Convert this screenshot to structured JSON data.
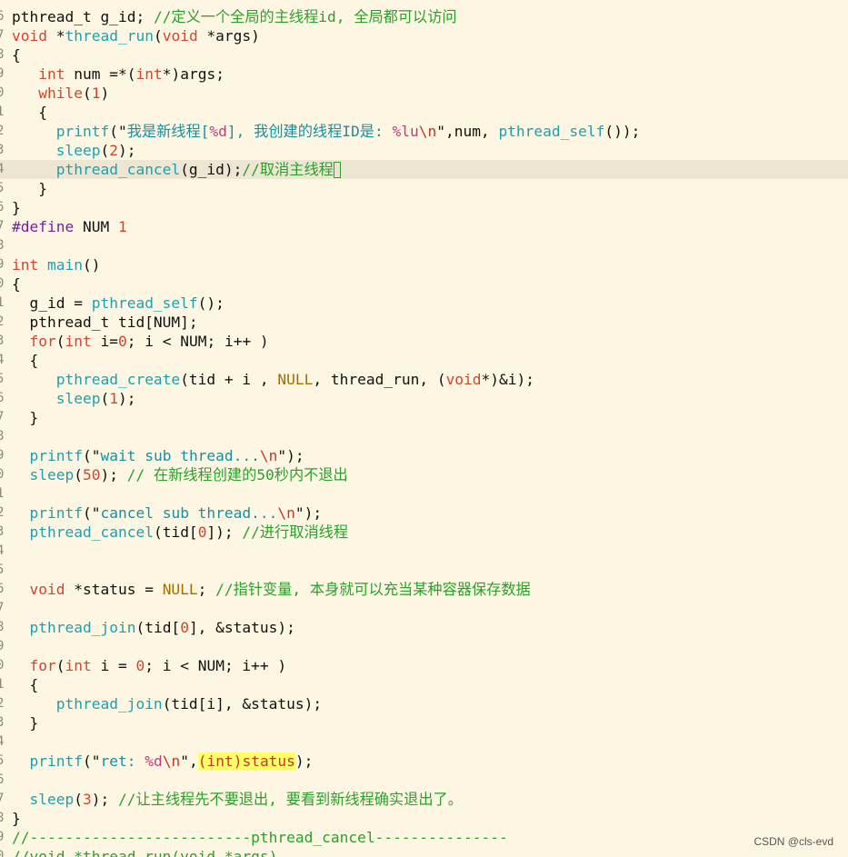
{
  "editor": {
    "cursor_line": 9,
    "lines": [
      {
        "g": "6",
        "t": [
          [
            "pthread_t g_id; ",
            "d"
          ],
          [
            "//定义一个全局的主线程id, 全局都可以访问",
            "c"
          ]
        ]
      },
      {
        "g": "7",
        "t": [
          [
            "void",
            "k"
          ],
          [
            " *",
            "d"
          ],
          [
            "thread_run",
            "f"
          ],
          [
            "(",
            "d"
          ],
          [
            "void",
            "k"
          ],
          [
            " *args)",
            "d"
          ]
        ]
      },
      {
        "g": "8",
        "t": [
          [
            "{",
            "d"
          ]
        ]
      },
      {
        "g": "9",
        "t": [
          [
            "   ",
            "d"
          ],
          [
            "int",
            "k"
          ],
          [
            " num =*(",
            "d"
          ],
          [
            "int",
            "k"
          ],
          [
            "*)args;",
            "d"
          ]
        ]
      },
      {
        "g": "0",
        "t": [
          [
            "   ",
            "d"
          ],
          [
            "while",
            "k"
          ],
          [
            "(",
            "d"
          ],
          [
            "1",
            "n"
          ],
          [
            ")",
            "d"
          ]
        ]
      },
      {
        "g": "1",
        "t": [
          [
            "   {",
            "d"
          ]
        ]
      },
      {
        "g": "2",
        "t": [
          [
            "     ",
            "d"
          ],
          [
            "printf",
            "f"
          ],
          [
            "(\"",
            "d"
          ],
          [
            "我是新线程[",
            "s"
          ],
          [
            "%d",
            "fmt"
          ],
          [
            "], 我创建的线程ID是: ",
            "s"
          ],
          [
            "%lu",
            "fmt"
          ],
          [
            "\\n",
            "esc"
          ],
          [
            "\"",
            "d"
          ],
          [
            ",num, ",
            "d"
          ],
          [
            "pthread_self",
            "f"
          ],
          [
            "());",
            "d"
          ]
        ]
      },
      {
        "g": "3",
        "t": [
          [
            "     ",
            "d"
          ],
          [
            "sleep",
            "f"
          ],
          [
            "(",
            "d"
          ],
          [
            "2",
            "n"
          ],
          [
            ");",
            "d"
          ]
        ]
      },
      {
        "g": "4",
        "t": [
          [
            "     ",
            "d"
          ],
          [
            "pthread_cancel",
            "f"
          ],
          [
            "(g_id);",
            "d"
          ],
          [
            "//取消主线程",
            "c"
          ]
        ],
        "cursor": true
      },
      {
        "g": "5",
        "t": [
          [
            "   }",
            "d"
          ]
        ]
      },
      {
        "g": "6",
        "t": [
          [
            "}",
            "d"
          ]
        ]
      },
      {
        "g": "7",
        "t": [
          [
            "#define",
            "pp"
          ],
          [
            " NUM ",
            "d"
          ],
          [
            "1",
            "n"
          ]
        ]
      },
      {
        "g": "8",
        "t": [
          [
            "",
            "d"
          ]
        ]
      },
      {
        "g": "9",
        "t": [
          [
            "int",
            "k"
          ],
          [
            " ",
            "d"
          ],
          [
            "main",
            "f"
          ],
          [
            "()",
            "d"
          ]
        ]
      },
      {
        "g": "0",
        "t": [
          [
            "{",
            "d"
          ]
        ]
      },
      {
        "g": "1",
        "t": [
          [
            "  g_id = ",
            "d"
          ],
          [
            "pthread_self",
            "f"
          ],
          [
            "();",
            "d"
          ]
        ]
      },
      {
        "g": "2",
        "t": [
          [
            "  pthread_t tid[NUM];",
            "d"
          ]
        ]
      },
      {
        "g": "3",
        "t": [
          [
            "  ",
            "d"
          ],
          [
            "for",
            "k"
          ],
          [
            "(",
            "d"
          ],
          [
            "int",
            "k"
          ],
          [
            " i=",
            "d"
          ],
          [
            "0",
            "n"
          ],
          [
            "; i < NUM; i++ )",
            "d"
          ]
        ]
      },
      {
        "g": "4",
        "t": [
          [
            "  {",
            "d"
          ]
        ]
      },
      {
        "g": "5",
        "t": [
          [
            "     ",
            "d"
          ],
          [
            "pthread_create",
            "f"
          ],
          [
            "(tid + i , ",
            "d"
          ],
          [
            "NULL",
            "null"
          ],
          [
            ", thread_run, (",
            "d"
          ],
          [
            "void",
            "k"
          ],
          [
            "*)&i);",
            "d"
          ]
        ]
      },
      {
        "g": "6",
        "t": [
          [
            "     ",
            "d"
          ],
          [
            "sleep",
            "f"
          ],
          [
            "(",
            "d"
          ],
          [
            "1",
            "n"
          ],
          [
            ");",
            "d"
          ]
        ]
      },
      {
        "g": "7",
        "t": [
          [
            "  }",
            "d"
          ]
        ]
      },
      {
        "g": "8",
        "t": [
          [
            "",
            "d"
          ]
        ]
      },
      {
        "g": "9",
        "t": [
          [
            "  ",
            "d"
          ],
          [
            "printf",
            "f"
          ],
          [
            "(\"",
            "d"
          ],
          [
            "wait sub thread...",
            "s"
          ],
          [
            "\\n",
            "esc"
          ],
          [
            "\");",
            "d"
          ]
        ]
      },
      {
        "g": "0",
        "t": [
          [
            "  ",
            "d"
          ],
          [
            "sleep",
            "f"
          ],
          [
            "(",
            "d"
          ],
          [
            "50",
            "n"
          ],
          [
            "); ",
            "d"
          ],
          [
            "// 在新线程创建的50秒内不退出",
            "c"
          ]
        ]
      },
      {
        "g": "1",
        "t": [
          [
            "",
            "d"
          ]
        ]
      },
      {
        "g": "2",
        "t": [
          [
            "  ",
            "d"
          ],
          [
            "printf",
            "f"
          ],
          [
            "(\"",
            "d"
          ],
          [
            "cancel sub thread...",
            "s"
          ],
          [
            "\\n",
            "esc"
          ],
          [
            "\");",
            "d"
          ]
        ]
      },
      {
        "g": "3",
        "t": [
          [
            "  ",
            "d"
          ],
          [
            "pthread_cancel",
            "f"
          ],
          [
            "(tid[",
            "d"
          ],
          [
            "0",
            "n"
          ],
          [
            "]); ",
            "d"
          ],
          [
            "//进行取消线程",
            "c"
          ]
        ]
      },
      {
        "g": "4",
        "t": [
          [
            "",
            "d"
          ]
        ]
      },
      {
        "g": "5",
        "t": [
          [
            "",
            "d"
          ]
        ]
      },
      {
        "g": "6",
        "t": [
          [
            "  ",
            "d"
          ],
          [
            "void",
            "k"
          ],
          [
            " *status = ",
            "d"
          ],
          [
            "NULL",
            "null"
          ],
          [
            "; ",
            "d"
          ],
          [
            "//指针变量, 本身就可以充当某种容器保存数据",
            "c"
          ]
        ]
      },
      {
        "g": "7",
        "t": [
          [
            "",
            "d"
          ]
        ]
      },
      {
        "g": "8",
        "t": [
          [
            "  ",
            "d"
          ],
          [
            "pthread_join",
            "f"
          ],
          [
            "(tid[",
            "d"
          ],
          [
            "0",
            "n"
          ],
          [
            "], &status);",
            "d"
          ]
        ]
      },
      {
        "g": "9",
        "t": [
          [
            "",
            "d"
          ]
        ]
      },
      {
        "g": "0",
        "t": [
          [
            "  ",
            "d"
          ],
          [
            "for",
            "k"
          ],
          [
            "(",
            "d"
          ],
          [
            "int",
            "k"
          ],
          [
            " i = ",
            "d"
          ],
          [
            "0",
            "n"
          ],
          [
            "; i < NUM; i++ )",
            "d"
          ]
        ]
      },
      {
        "g": "1",
        "t": [
          [
            "  {",
            "d"
          ]
        ]
      },
      {
        "g": "2",
        "t": [
          [
            "     ",
            "d"
          ],
          [
            "pthread_join",
            "f"
          ],
          [
            "(tid[i], &status);",
            "d"
          ]
        ]
      },
      {
        "g": "3",
        "t": [
          [
            "  }",
            "d"
          ]
        ]
      },
      {
        "g": "4",
        "t": [
          [
            "",
            "d"
          ]
        ]
      },
      {
        "g": "5",
        "t": [
          [
            "  ",
            "d"
          ],
          [
            "printf",
            "f"
          ],
          [
            "(\"",
            "d"
          ],
          [
            "ret: ",
            "s"
          ],
          [
            "%d",
            "fmt"
          ],
          [
            "\\n",
            "esc"
          ],
          [
            "\",",
            "d"
          ],
          [
            "(int)status",
            "hl"
          ],
          [
            ");",
            "d"
          ]
        ]
      },
      {
        "g": "6",
        "t": [
          [
            "",
            "d"
          ]
        ]
      },
      {
        "g": "7",
        "t": [
          [
            "  ",
            "d"
          ],
          [
            "sleep",
            "f"
          ],
          [
            "(",
            "d"
          ],
          [
            "3",
            "n"
          ],
          [
            "); ",
            "d"
          ],
          [
            "//让主线程先不要退出, 要看到新线程确实退出了。",
            "c"
          ]
        ]
      },
      {
        "g": "8",
        "t": [
          [
            "}",
            "d"
          ]
        ]
      },
      {
        "g": "9",
        "t": [
          [
            "//-------------------------pthread_cancel---------------",
            "c"
          ]
        ]
      },
      {
        "g": "0",
        "t": [
          [
            "//void *thread_run(void *args)",
            "c"
          ]
        ]
      }
    ]
  },
  "watermark": "CSDN @cls-evd",
  "colors": {
    "background": "#fdf6e3",
    "keyword": "#d1462f",
    "function": "#1f9fae",
    "comment": "#2ca02c",
    "highlight": "#ffff66"
  }
}
